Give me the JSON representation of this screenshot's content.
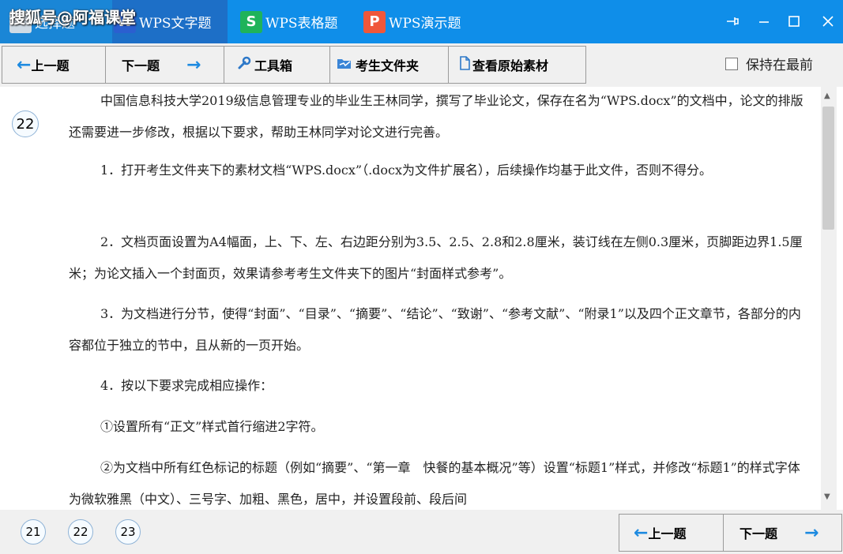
{
  "watermark": "搜狐号@阿福课堂",
  "tabs": [
    {
      "label": "选择题",
      "icon": "choice-icon"
    },
    {
      "label": "WPS文字题",
      "icon": "wps-writer-icon",
      "icon_char": "W"
    },
    {
      "label": "WPS表格题",
      "icon": "wps-spreadsheet-icon",
      "icon_char": "S"
    },
    {
      "label": "WPS演示题",
      "icon": "wps-presentation-icon",
      "icon_char": "P"
    }
  ],
  "window_controls": {
    "pin": "pin-icon",
    "minimize": "minimize-icon",
    "maximize": "maximize-icon",
    "close": "close-icon"
  },
  "toolbar": {
    "prev_label": "上一题",
    "next_label": "下一题",
    "tools_label": "工具箱",
    "folder_label": "考生文件夹",
    "source_label": "查看原始素材",
    "keep_on_top_label": "保持在最前",
    "keep_on_top_checked": false
  },
  "question": {
    "number": "22",
    "paragraphs": [
      "中国信息科技大学2019级信息管理专业的毕业生王林同学，撰写了毕业论文，保存在名为“WPS.docx”的文档中，论文的排版还需要进一步修改，根据以下要求，帮助王林同学对论文进行完善。",
      "1．打开考生文件夹下的素材文档“WPS.docx”（.docx为文件扩展名），后续操作均基于此文件，否则不得分。",
      "2．文档页面设置为A4幅面，上、下、左、右边距分别为3.5、2.5、2.8和2.8厘米，装订线在左侧0.3厘米，页脚距边界1.5厘米；为论文插入一个封面页，效果请参考考生文件夹下的图片“封面样式参考”。",
      "3．为文档进行分节，使得“封面”、“目录”、“摘要”、“结论”、“致谢”、“参考文献”、“附录1”以及四个正文章节，各部分的内容都位于独立的节中，且从新的一页开始。",
      "4．按以下要求完成相应操作：",
      "①设置所有“正文”样式首行缩进2字符。",
      "②为文档中所有红色标记的标题（例如“摘要”、“第一章　快餐的基本概况”等）设置“标题1”样式，并修改“标题1”的样式字体为微软雅黑（中文）、三号字、加粗、黑色，居中，并设置段前、段后间"
    ]
  },
  "bottom": {
    "question_numbers": [
      "21",
      "22",
      "23"
    ],
    "prev_label": "上一题",
    "next_label": "下一题"
  },
  "colors": {
    "title_bar": "#0f8ee9",
    "accent_arrow": "#1d8ae0"
  }
}
